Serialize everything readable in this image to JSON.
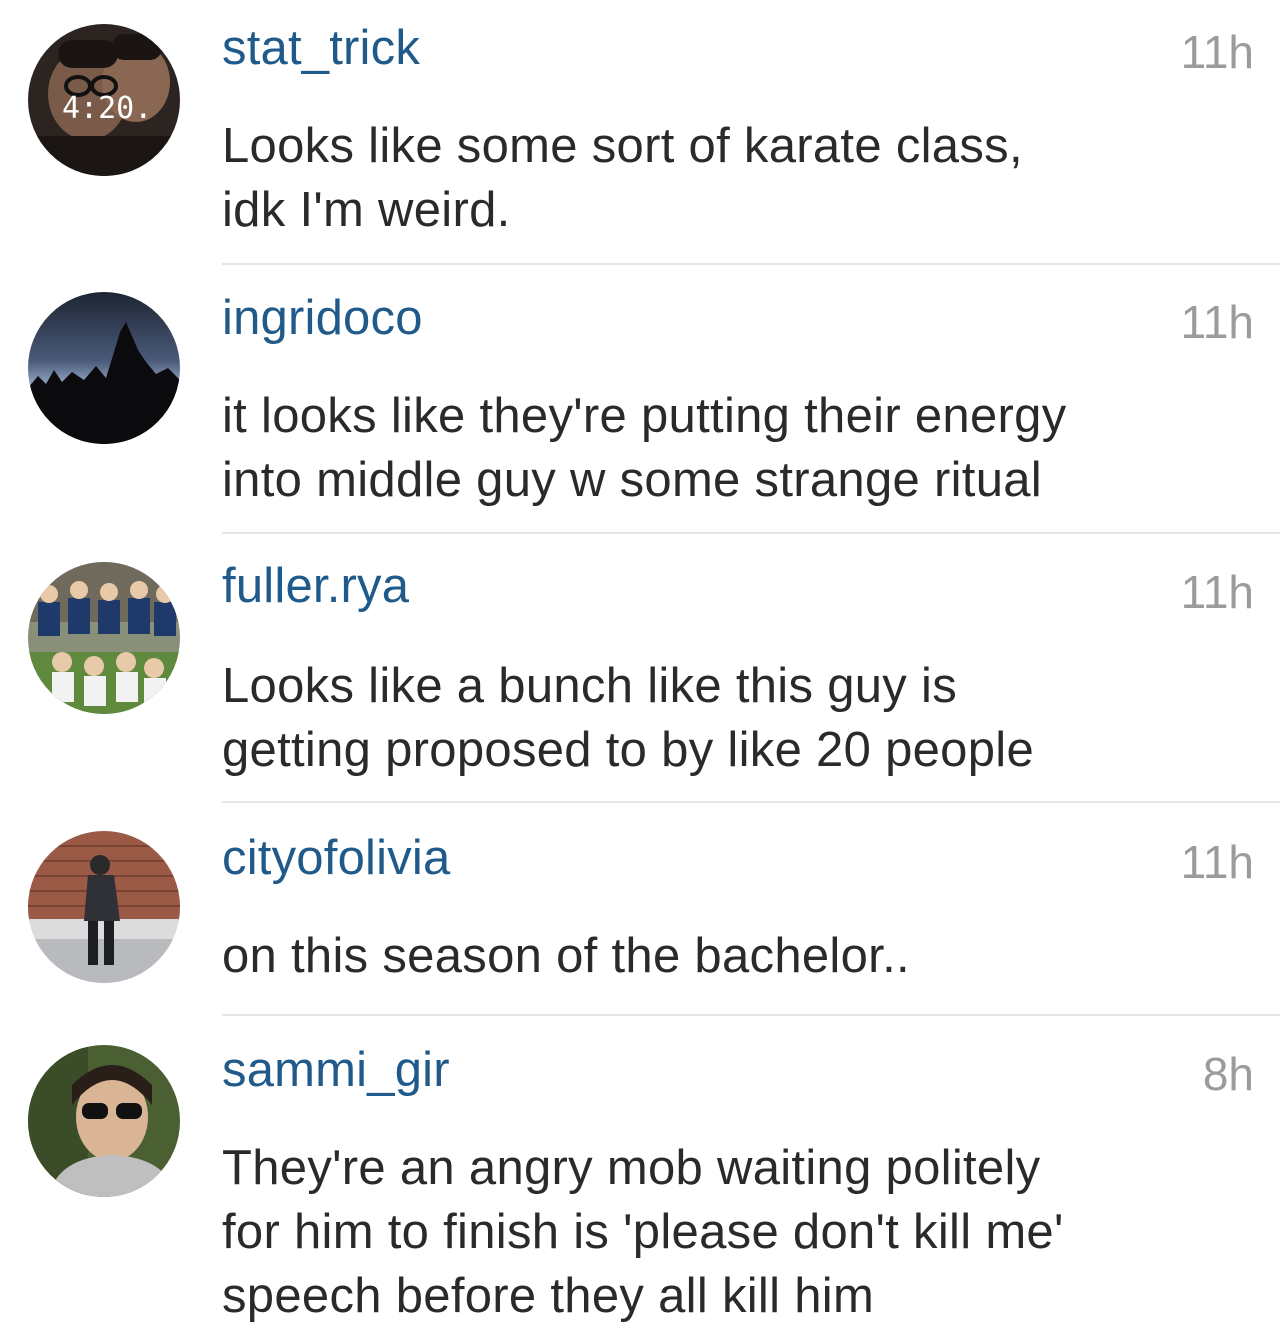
{
  "comments": [
    {
      "username": "stat_trick",
      "time": "11h",
      "text": "Looks like some sort of karate class,\nidk I'm weird.",
      "avatar_overlay": "4:20."
    },
    {
      "username": "ingridoco",
      "time": "11h",
      "text": "it looks like they're putting their energy\ninto middle guy w some strange ritual"
    },
    {
      "username": "fuller.rya",
      "time": "11h",
      "text": "Looks like a bunch like this guy is\ngetting proposed to by like 20 people"
    },
    {
      "username": "cityofolivia",
      "time": "11h",
      "text": "on this season of the bachelor.."
    },
    {
      "username": "sammi_gir",
      "time": "8h",
      "text": "They're an angry mob waiting politely\nfor him to finish is 'please don't kill me'\nspeech before they all kill him"
    }
  ],
  "colors": {
    "username": "#1f5a8a",
    "timestamp": "#9b9b9b",
    "comment_text": "#2a2a2a",
    "divider": "#e6e6e6",
    "background": "#ffffff"
  }
}
